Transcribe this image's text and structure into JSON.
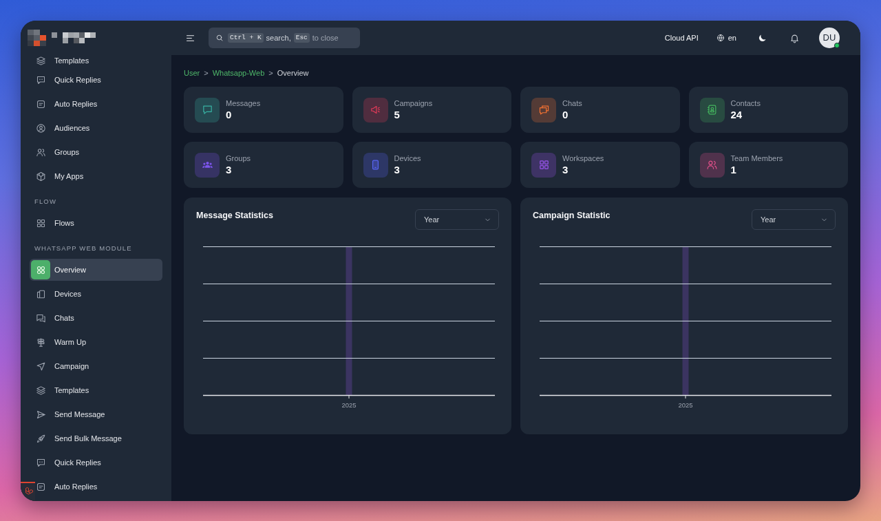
{
  "sidebar": {
    "sections": [
      {
        "items": [
          {
            "label": "Templates",
            "selected": false
          },
          {
            "label": "Quick Replies",
            "selected": false
          },
          {
            "label": "Auto Replies",
            "selected": false
          },
          {
            "label": "Audiences",
            "selected": false
          },
          {
            "label": "Groups",
            "selected": false
          },
          {
            "label": "My Apps",
            "selected": false
          }
        ]
      },
      {
        "title": "FLOW",
        "items": [
          {
            "label": "Flows",
            "selected": false
          }
        ]
      },
      {
        "title": "WHATSAPP WEB MODULE",
        "items": [
          {
            "label": "Overview",
            "selected": true
          },
          {
            "label": "Devices",
            "selected": false
          },
          {
            "label": "Chats",
            "selected": false
          },
          {
            "label": "Warm Up",
            "selected": false
          },
          {
            "label": "Campaign",
            "selected": false
          },
          {
            "label": "Templates",
            "selected": false
          },
          {
            "label": "Send Message",
            "selected": false
          },
          {
            "label": "Send Bulk Message",
            "selected": false
          },
          {
            "label": "Quick Replies",
            "selected": false
          },
          {
            "label": "Auto Replies",
            "selected": false
          }
        ]
      }
    ]
  },
  "top_bar": {
    "search": {
      "shortcut_key": "Ctrl + K",
      "shortcut_hint": "search,",
      "close_key": "Esc",
      "close_hint": "to close"
    },
    "api_mode": "Cloud API",
    "language": "en",
    "user": {
      "initials": "DU",
      "online": true
    }
  },
  "breadcrumb": [
    {
      "kind": "link",
      "text": "User"
    },
    {
      "kind": "separator",
      "text": ">"
    },
    {
      "kind": "link",
      "text": "Whatsapp-Web"
    },
    {
      "kind": "separator",
      "text": ">"
    },
    {
      "kind": "current",
      "text": "Overview"
    }
  ],
  "stats": [
    {
      "label": "Messages",
      "value": "0",
      "color": "#38b2a3"
    },
    {
      "label": "Campaigns",
      "value": "5",
      "color": "#e23a58"
    },
    {
      "label": "Chats",
      "value": "0",
      "color": "#f47232"
    },
    {
      "label": "Contacts",
      "value": "24",
      "color": "#43b55e"
    },
    {
      "label": "Groups",
      "value": "3",
      "color": "#7c55ec"
    },
    {
      "label": "Devices",
      "value": "3",
      "color": "#5865f2"
    },
    {
      "label": "Workspaces",
      "value": "3",
      "color": "#9b55ef"
    },
    {
      "label": "Team Members",
      "value": "1",
      "color": "#e2508a"
    }
  ],
  "charts": [
    {
      "title": "Message Statistics",
      "period": "Year",
      "x_labels": [
        "2025"
      ]
    },
    {
      "title": "Campaign Statistic",
      "period": "Year",
      "x_labels": [
        "2025"
      ]
    }
  ]
}
